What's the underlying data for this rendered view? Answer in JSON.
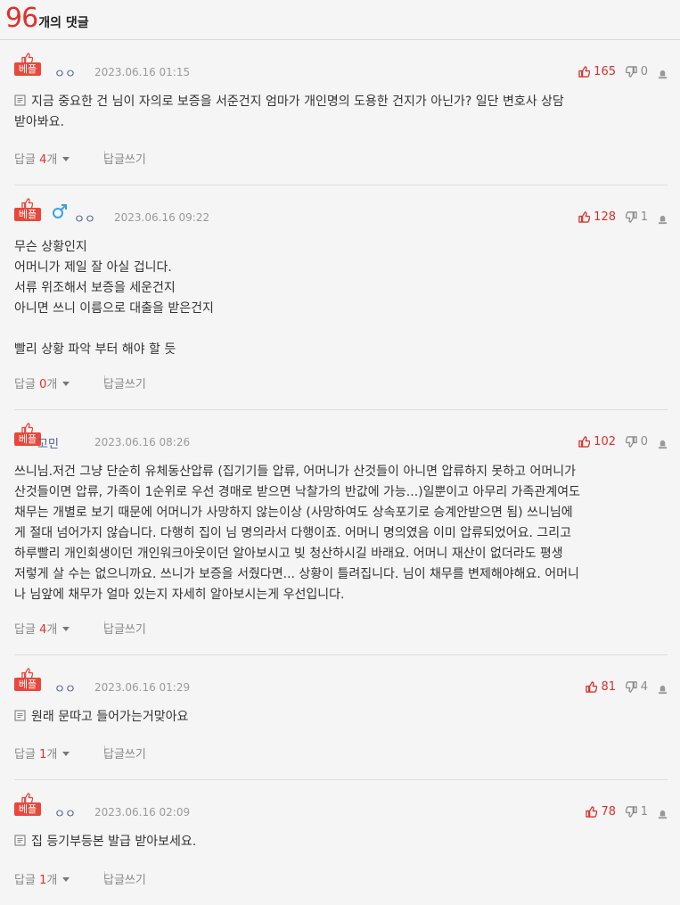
{
  "header": {
    "count": "96",
    "label": "개의 댓글"
  },
  "best_label": "베플",
  "reply_prefix": "답글 ",
  "reply_suffix": "개",
  "write_label": "답글쓰기",
  "colors": {
    "accent": "#e0302a",
    "badge": "#e8473c",
    "author": "#4a5a8c",
    "male": "#3aa0e0"
  },
  "comments": [
    {
      "author": "ㅇㅇ",
      "gender": "",
      "date": "2023.06.16 01:15",
      "likes": "165",
      "dislikes": "0",
      "replies": "4",
      "lines": [
        "지금 중요한 건 님이 자의로 보증을 서준건지 엄마가 개인명의 도용한 건지가 아닌가? 일단 변호사 상담",
        "받아봐요."
      ]
    },
    {
      "author": "ㅇㅇ",
      "gender": "male",
      "date": "2023.06.16 09:22",
      "likes": "128",
      "dislikes": "1",
      "replies": "0",
      "lines": [
        "무슨 상황인지",
        "어머니가 제일 잘 아실 겁니다.",
        "서류 위조해서 보증을 세운건지",
        "아니면 쓰니 이름으로 대출을 받은건지",
        "",
        "빨리 상황 파악 부터 해야 할 듯"
      ]
    },
    {
      "author": "고민",
      "gender": "",
      "date": "2023.06.16 08:26",
      "likes": "102",
      "dislikes": "0",
      "replies": "4",
      "lines": [
        "쓰니님.저건 그냥 단순히 유체동산압류 (집기기들 압류, 어머니가 산것들이 아니면 압류하지 못하고 어머니가",
        "산것들이면 압류, 가족이 1순위로 우선 경매로 받으면 낙찰가의 반값에 가능...)일뿐이고 아무리 가족관계여도",
        "채무는 개별로 보기 때문에 어머니가 사망하지 않는이상 (사망하여도 상속포기로 승계안받으면 됨) 쓰니님에",
        "게 절대 넘어가지 않습니다. 다행히 집이 님 명의라서 다행이죠. 어머니 명의였음 이미 압류되었어요. 그리고",
        "하루빨리 개인회생이던 개인워크아웃이던 알아보시고 빚 청산하시길 바래요. 어머니 재산이 없더라도 평생",
        "저렇게 살 수는 없으니까요. 쓰니가 보증을 서줬다면... 상황이 틀려집니다. 님이 채무를 변제해야해요. 어머니",
        "나 님앞에 채무가 얼마 있는지 자세히 알아보시는게 우선입니다."
      ]
    },
    {
      "author": "ㅇㅇ",
      "gender": "",
      "date": "2023.06.16 01:29",
      "likes": "81",
      "dislikes": "4",
      "replies": "1",
      "lines": [
        "원래 문따고 들어가는거맞아요"
      ]
    },
    {
      "author": "ㅇㅇ",
      "gender": "",
      "date": "2023.06.16 02:09",
      "likes": "78",
      "dislikes": "1",
      "replies": "1",
      "lines": [
        "집 등기부등본 발급 받아보세요."
      ]
    }
  ]
}
